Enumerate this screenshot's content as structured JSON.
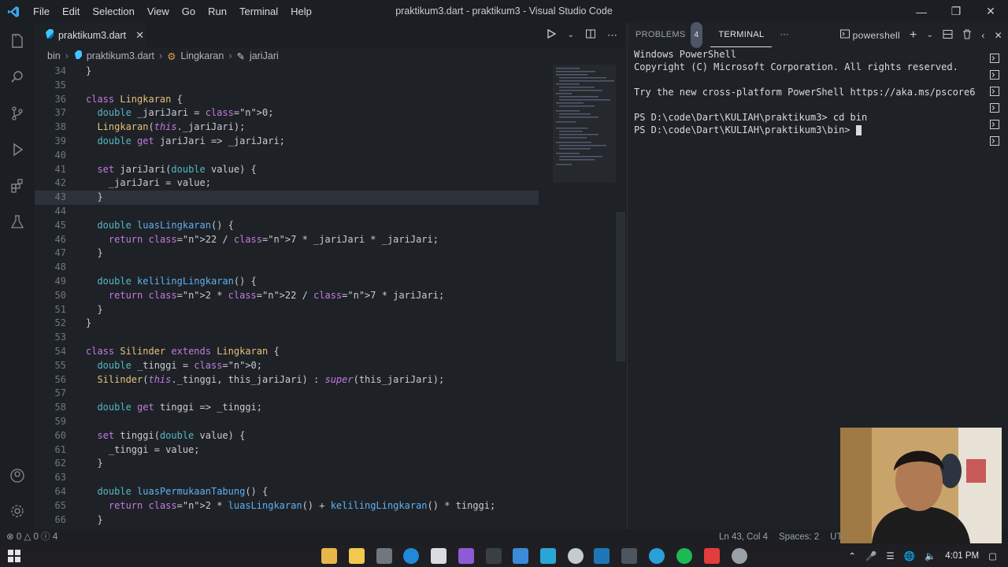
{
  "window": {
    "title": "praktikum3.dart - praktikum3 - Visual Studio Code",
    "menu": [
      "File",
      "Edit",
      "Selection",
      "View",
      "Go",
      "Run",
      "Terminal",
      "Help"
    ]
  },
  "editor": {
    "tab": {
      "label": "praktikum3.dart",
      "icon": "dart-icon"
    },
    "breadcrumb": [
      "bin",
      "praktikum3.dart",
      "Lingkaran",
      "jariJari"
    ],
    "current_line": 43,
    "lines": [
      {
        "n": "34",
        "t": "}"
      },
      {
        "n": "35",
        "t": ""
      },
      {
        "n": "36",
        "t": "class Lingkaran {"
      },
      {
        "n": "37",
        "t": "  double _jariJari = 0;"
      },
      {
        "n": "38",
        "t": "  Lingkaran(this._jariJari);"
      },
      {
        "n": "39",
        "t": "  double get jariJari => _jariJari;"
      },
      {
        "n": "40",
        "t": ""
      },
      {
        "n": "41",
        "t": "  set jariJari(double value) {"
      },
      {
        "n": "42",
        "t": "    _jariJari = value;"
      },
      {
        "n": "43",
        "t": "  }"
      },
      {
        "n": "44",
        "t": ""
      },
      {
        "n": "45",
        "t": "  double luasLingkaran() {"
      },
      {
        "n": "46",
        "t": "    return 22 / 7 * _jariJari * _jariJari;"
      },
      {
        "n": "47",
        "t": "  }"
      },
      {
        "n": "48",
        "t": ""
      },
      {
        "n": "49",
        "t": "  double kelilingLingkaran() {"
      },
      {
        "n": "50",
        "t": "    return 2 * 22 / 7 * jariJari;"
      },
      {
        "n": "51",
        "t": "  }"
      },
      {
        "n": "52",
        "t": "}"
      },
      {
        "n": "53",
        "t": ""
      },
      {
        "n": "54",
        "t": "class Silinder extends Lingkaran {"
      },
      {
        "n": "55",
        "t": "  double _tinggi = 0;"
      },
      {
        "n": "56",
        "t": "  Silinder(this._tinggi, this_jariJari) : super(this_jariJari);"
      },
      {
        "n": "57",
        "t": ""
      },
      {
        "n": "58",
        "t": "  double get tinggi => _tinggi;"
      },
      {
        "n": "59",
        "t": ""
      },
      {
        "n": "60",
        "t": "  set tinggi(double value) {"
      },
      {
        "n": "61",
        "t": "    _tinggi = value;"
      },
      {
        "n": "62",
        "t": "  }"
      },
      {
        "n": "63",
        "t": ""
      },
      {
        "n": "64",
        "t": "  double luasPermukaanTabung() {"
      },
      {
        "n": "65",
        "t": "    return 2 * luasLingkaran() + kelilingLingkaran() * tinggi;"
      },
      {
        "n": "66",
        "t": "  }"
      }
    ]
  },
  "panel": {
    "tabs": [
      {
        "label": "PROBLEMS",
        "badge": "4"
      },
      {
        "label": "TERMINAL"
      }
    ],
    "shell": "powershell",
    "terminal_lines": [
      "Windows PowerShell",
      "Copyright (C) Microsoft Corporation. All rights reserved.",
      "",
      "Try the new cross-platform PowerShell https://aka.ms/pscore6",
      "",
      "PS D:\\code\\Dart\\KULIAH\\praktikum3> cd bin",
      "PS D:\\code\\Dart\\KULIAH\\praktikum3\\bin> "
    ]
  },
  "status": {
    "errors": "0",
    "warnings": "0",
    "infos": "4",
    "position": "Ln 43, Col 4",
    "spaces": "Spaces: 2",
    "encoding": "UTF"
  },
  "taskbar": {
    "time": "4:01 PM"
  },
  "colors": {
    "keyword": "#c678dd",
    "type": "#56b6c2",
    "function": "#61afef",
    "number": "#d19a66",
    "accent": "#61afef"
  }
}
